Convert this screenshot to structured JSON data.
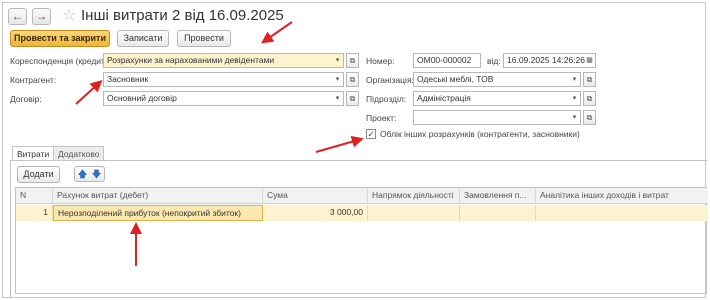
{
  "window": {
    "nav_back": "←",
    "nav_forward": "→",
    "star": "☆",
    "title": "Інші витрати 2 від 16.09.2025"
  },
  "toolbar": {
    "post_close_label": "Провести та закрити",
    "save_label": "Записати",
    "post_label": "Провести"
  },
  "form": {
    "correspondence_label": "Кореспонденція (кредит):",
    "correspondence_value": "Розрахунки за нарахованими девідентами",
    "counterparty_label": "Контрагент:",
    "counterparty_value": "Засновник",
    "contract_label": "Договір:",
    "contract_value": "Основний договір",
    "number_label": "Номер:",
    "number_value": "ОМ00-000002",
    "date_label": "від:",
    "date_value": "16.09.2025 14:26:26",
    "organization_label": "Організація:",
    "organization_value": "Одеські меблі, ТОВ",
    "department_label": "Підрозділ:",
    "department_value": "Адміністрація",
    "project_label": "Проект:",
    "project_value": "",
    "other_settlements_label": "Облік інших розрахунків (контрагенти, засновники)",
    "other_settlements_checked": true,
    "dropdown_glyph": "▾",
    "open_glyph": "⧉",
    "calendar_glyph": "▦"
  },
  "tabs": [
    {
      "label": "Витрати",
      "active": true
    },
    {
      "label": "Додатково",
      "active": false
    }
  ],
  "table_toolbar": {
    "add_label": "Додати",
    "up_glyph": "🡅",
    "down_glyph": "🡇"
  },
  "table": {
    "columns": [
      "N",
      "Рахунок витрат (дебет)",
      "Сума",
      "Напрямок діяльності",
      "Замовлення п...",
      "Аналітика інших доходів і витрат"
    ],
    "rows": [
      {
        "n": "1",
        "account": "Нерозподілений прибуток (непокритий збиток)",
        "amount": "3 000,00",
        "direction": "",
        "order": "",
        "analytics": ""
      }
    ]
  },
  "colors": {
    "accent": "#f0b43a",
    "highlight": "#fdf3cf",
    "annotation_arrow": "#e02020"
  }
}
